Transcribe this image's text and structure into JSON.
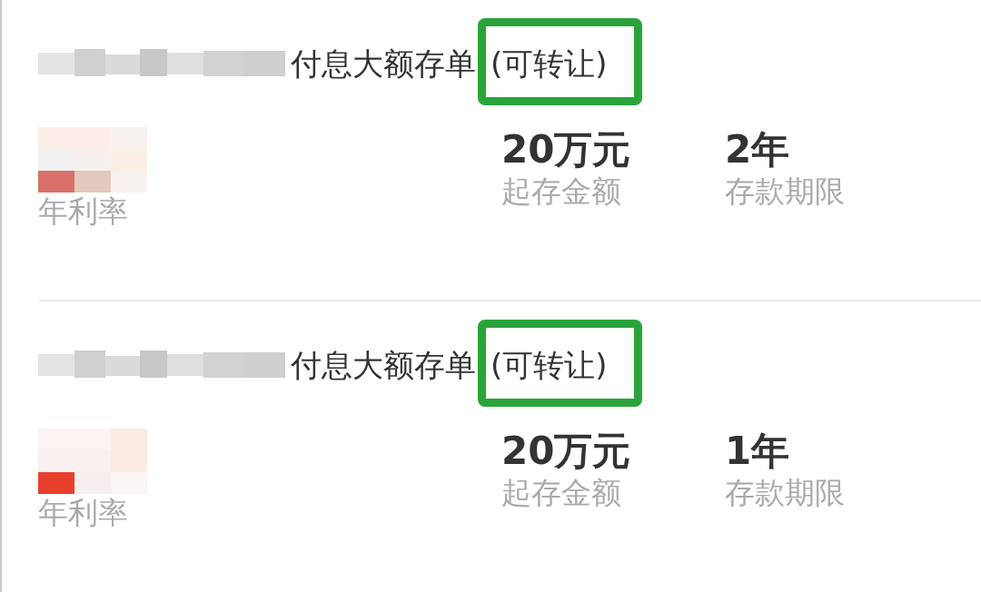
{
  "products": [
    {
      "title": "付息大额存单",
      "title_note": "(可转让)",
      "highlighted": true,
      "rate_label": "年利率",
      "amount": "20万元",
      "amount_label": "起存金额",
      "term": "2年",
      "term_label": "存款期限"
    },
    {
      "title": "付息大额存单",
      "title_note": "(可转让)",
      "highlighted": true,
      "rate_label": "年利率",
      "amount": "20万元",
      "amount_label": "起存金额",
      "term": "1年",
      "term_label": "存款期限"
    }
  ]
}
